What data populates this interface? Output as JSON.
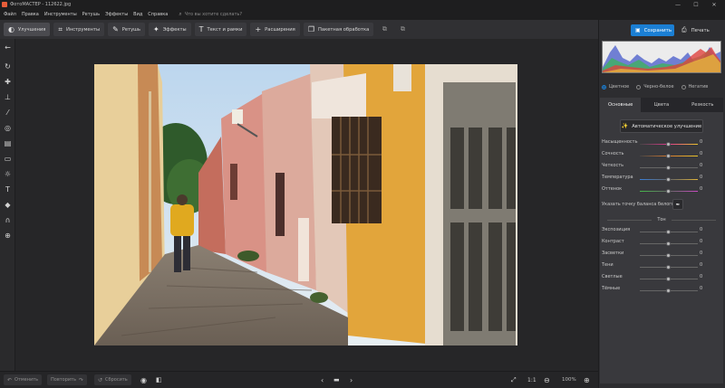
{
  "window": {
    "title": "ФотоМАСТЕР - 112622.jpg",
    "min": "—",
    "max": "☐",
    "close": "✕"
  },
  "menu": [
    "Файл",
    "Правка",
    "Инструменты",
    "Ретушь",
    "Эффекты",
    "Вид",
    "Справка"
  ],
  "search": {
    "placeholder": "Что вы хотите сделать?"
  },
  "toolbar": {
    "tabs": [
      {
        "label": "Улучшения",
        "icon": "enhance-icon",
        "active": true
      },
      {
        "label": "Инструменты",
        "icon": "crop-icon"
      },
      {
        "label": "Ретушь",
        "icon": "brush-icon"
      },
      {
        "label": "Эффекты",
        "icon": "effects-icon"
      },
      {
        "label": "Текст и рамки",
        "icon": "text-icon"
      },
      {
        "label": "Расширения",
        "icon": "plus-icon"
      },
      {
        "label": "Пакетная обработка",
        "icon": "batch-icon"
      }
    ]
  },
  "actions": {
    "save_label": "Сохранить",
    "print_label": "Печать"
  },
  "color_modes": [
    {
      "label": "Цветное",
      "selected": true
    },
    {
      "label": "Черно-белое",
      "selected": false
    },
    {
      "label": "Негатив",
      "selected": false
    }
  ],
  "panel_tabs": [
    {
      "label": "Основные",
      "active": true
    },
    {
      "label": "Цвета",
      "active": false
    },
    {
      "label": "Резкость",
      "active": false
    }
  ],
  "auto_button": "Автоматическое улучшение",
  "sliders": [
    {
      "label": "Насыщенность",
      "value": "0",
      "gradient": "linear-gradient(90deg,#444,#e23a8d,#e8c52b)"
    },
    {
      "label": "Сочность",
      "value": "0",
      "gradient": "linear-gradient(90deg,#444,#d97b2f,#e8c52b)"
    },
    {
      "label": "Четкость",
      "value": "0",
      "gradient": "#666"
    },
    {
      "label": "Температура",
      "value": "0",
      "gradient": "linear-gradient(90deg,#3a7fd8,#666,#e0b43a)"
    },
    {
      "label": "Оттенок",
      "value": "0",
      "gradient": "linear-gradient(90deg,#45b94a,#666,#c94ac2)"
    }
  ],
  "white_balance_label": "Указать точку баланса белого",
  "tone_section": "Тон",
  "tone_sliders": [
    {
      "label": "Экспозиция",
      "value": "0"
    },
    {
      "label": "Контраст",
      "value": "0"
    },
    {
      "label": "Засветки",
      "value": "0"
    },
    {
      "label": "Тени",
      "value": "0"
    },
    {
      "label": "Светлые",
      "value": "0"
    },
    {
      "label": "Тёмные",
      "value": "0"
    }
  ],
  "bottom": {
    "undo": "Отменить",
    "redo": "Повторить",
    "reset": "Сбросить",
    "ratio": "1:1",
    "zoom": "100%"
  }
}
